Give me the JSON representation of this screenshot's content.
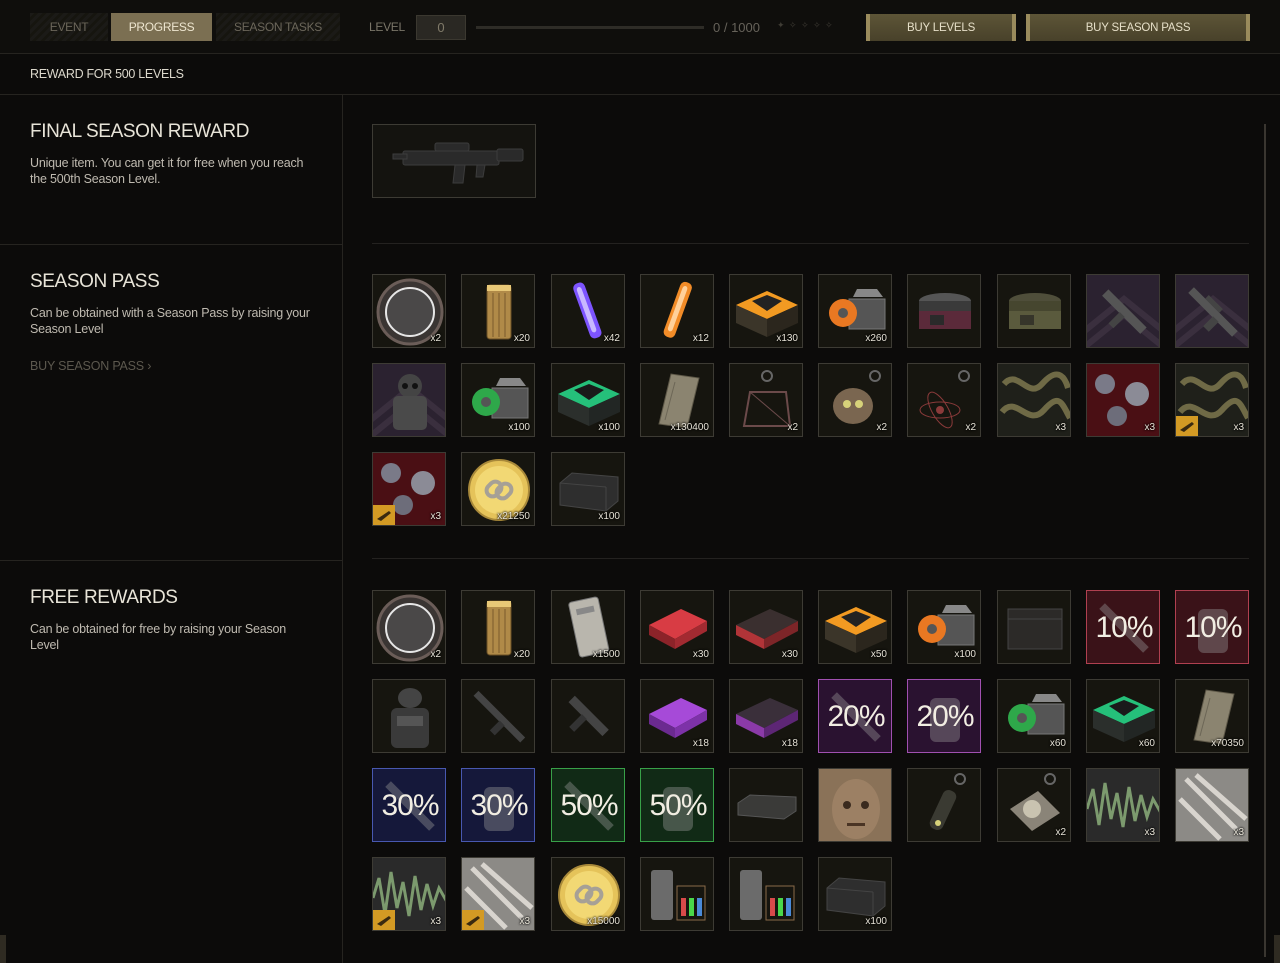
{
  "tabs": [
    {
      "label": "EVENT",
      "active": false
    },
    {
      "label": "PROGRESS",
      "active": true
    },
    {
      "label": "SEASON TASKS",
      "active": false
    }
  ],
  "level": {
    "label": "LEVEL",
    "value": "0",
    "progress_text": "0 / 1000",
    "progress_fraction": 0.0
  },
  "buttons": {
    "buy_levels": "BUY LEVELS",
    "buy_season_pass": "BUY SEASON PASS"
  },
  "reward_header": "REWARD FOR 500 LEVELS",
  "sections": {
    "final": {
      "title": "FINAL SEASON  REWARD",
      "desc": "Unique item. You can get it for free when you reach the 500th Season Level."
    },
    "pass": {
      "title": "SEASON PASS",
      "desc": "Can be obtained with a Season Pass by raising your Season Level",
      "link": "BUY SEASON PASS"
    },
    "free": {
      "title": "FREE REWARDS",
      "desc": "Can be obtained for free by raising your Season Level"
    }
  },
  "season_pass_items": [
    {
      "icon": "disc-icon",
      "qty": "x2"
    },
    {
      "icon": "canister-icon",
      "qty": "x20"
    },
    {
      "icon": "purple-glowstick-icon",
      "qty": "x42"
    },
    {
      "icon": "orange-glowstick-icon",
      "qty": "x12"
    },
    {
      "icon": "orange-crate-icon",
      "qty": "x130"
    },
    {
      "icon": "orange-box-icon",
      "qty": "x260"
    },
    {
      "icon": "bag-icon",
      "qty": ""
    },
    {
      "icon": "green-bag-icon",
      "qty": ""
    },
    {
      "icon": "smg-skin-icon",
      "qty": ""
    },
    {
      "icon": "rifle-skin-icon",
      "qty": ""
    },
    {
      "icon": "armor-skin-icon",
      "qty": ""
    },
    {
      "icon": "green-box-icon",
      "qty": "x100"
    },
    {
      "icon": "green-crate-icon",
      "qty": "x100"
    },
    {
      "icon": "plate-icon",
      "qty": "x130400"
    },
    {
      "icon": "charm-frame-icon",
      "qty": "x2"
    },
    {
      "icon": "charm-skull-icon",
      "qty": "x2"
    },
    {
      "icon": "charm-orbit-icon",
      "qty": "x2"
    },
    {
      "icon": "snake-pattern-icon",
      "qty": "x3"
    },
    {
      "icon": "blood-pattern-icon",
      "qty": "x3"
    },
    {
      "icon": "snake-pattern-gun-icon",
      "qty": "x3"
    },
    {
      "icon": "blood-pattern-gun-icon",
      "qty": "x3"
    },
    {
      "icon": "gold-coin-icon",
      "qty": "x21250"
    },
    {
      "icon": "black-crate-icon",
      "qty": "x100"
    }
  ],
  "free_items": [
    {
      "icon": "disc-icon",
      "qty": "x2"
    },
    {
      "icon": "canister-icon",
      "qty": "x20"
    },
    {
      "icon": "ticket-icon",
      "qty": "x1500"
    },
    {
      "icon": "red-case-icon",
      "qty": "x30"
    },
    {
      "icon": "red-crate-icon",
      "qty": "x30"
    },
    {
      "icon": "orange-crate-icon",
      "qty": "x50"
    },
    {
      "icon": "orange-box-icon",
      "qty": "x100"
    },
    {
      "icon": "dark-crate-icon",
      "qty": ""
    },
    {
      "icon": "weapon-discount-icon",
      "qty": "",
      "pct": "10%"
    },
    {
      "icon": "armor-discount-icon",
      "qty": "",
      "pct": "10%"
    },
    {
      "icon": "armor-icon",
      "qty": ""
    },
    {
      "icon": "rifle-icon",
      "qty": ""
    },
    {
      "icon": "smg-icon",
      "qty": ""
    },
    {
      "icon": "purple-case-icon",
      "qty": "x18"
    },
    {
      "icon": "purple-crate-icon",
      "qty": "x18"
    },
    {
      "icon": "weapon-discount-icon",
      "qty": "",
      "pct": "20%"
    },
    {
      "icon": "armor-discount-icon",
      "qty": "",
      "pct": "20%"
    },
    {
      "icon": "green-box-icon",
      "qty": "x60"
    },
    {
      "icon": "green-crate-icon",
      "qty": "x60"
    },
    {
      "icon": "plate-icon",
      "qty": "x70350"
    },
    {
      "icon": "weapon-discount-icon",
      "qty": "",
      "pct": "30%"
    },
    {
      "icon": "armor-discount-icon",
      "qty": "",
      "pct": "30%"
    },
    {
      "icon": "weapon-discount-icon",
      "qty": "",
      "pct": "50%"
    },
    {
      "icon": "armor-discount-icon",
      "qty": "",
      "pct": "50%"
    },
    {
      "icon": "small-crate-icon",
      "qty": ""
    },
    {
      "icon": "face-icon",
      "qty": ""
    },
    {
      "icon": "charm-bottle-icon",
      "qty": ""
    },
    {
      "icon": "charm-orb-icon",
      "qty": "x2"
    },
    {
      "icon": "wave-pattern-icon",
      "qty": "x3"
    },
    {
      "icon": "scratch-pattern-icon",
      "qty": "x3"
    },
    {
      "icon": "wave-pattern-gun-icon",
      "qty": "x3"
    },
    {
      "icon": "scratch-pattern-gun-icon",
      "qty": "x3"
    },
    {
      "icon": "gold-coin-icon",
      "qty": "x15000"
    },
    {
      "icon": "lab-kit-icon",
      "qty": ""
    },
    {
      "icon": "lab-kit-icon",
      "qty": ""
    },
    {
      "icon": "black-crate-icon",
      "qty": "x100"
    }
  ],
  "final_reward": {
    "icon": "assault-rifle-icon"
  },
  "colors": {
    "accent_gold": "#9a8b5c",
    "active_tab": "#7b6f52",
    "discount_red": "#c04040",
    "discount_purple": "#a050b0",
    "discount_blue": "#4050a0",
    "discount_green": "#30a040"
  }
}
